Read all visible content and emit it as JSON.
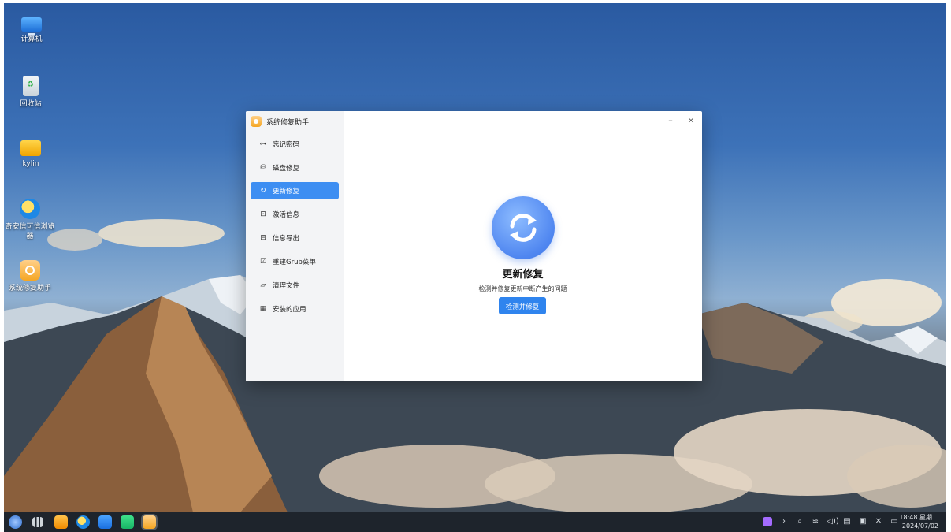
{
  "desktop": {
    "icons": [
      {
        "label": "计算机",
        "icon": "computer-icon"
      },
      {
        "label": "回收站",
        "icon": "trash-icon"
      },
      {
        "label": "kylin",
        "icon": "folder-icon"
      },
      {
        "label": "奇安信可信浏览器",
        "icon": "browser-icon"
      },
      {
        "label": "系统修复助手",
        "icon": "repair-assistant-icon"
      }
    ]
  },
  "window": {
    "title": "系统修复助手",
    "minimize_glyph": "–",
    "close_glyph": "×",
    "nav": [
      {
        "label": "忘记密码",
        "icon": "key-icon",
        "glyph": "⊶"
      },
      {
        "label": "磁盘修复",
        "icon": "disk-icon",
        "glyph": "⛁"
      },
      {
        "label": "更新修复",
        "icon": "refresh-icon",
        "glyph": "↻",
        "active": true
      },
      {
        "label": "激活信息",
        "icon": "activation-icon",
        "glyph": "⊡"
      },
      {
        "label": "信息导出",
        "icon": "export-icon",
        "glyph": "⊟"
      },
      {
        "label": "重建Grub菜单",
        "icon": "grub-icon",
        "glyph": "☑"
      },
      {
        "label": "清理文件",
        "icon": "folder-open-icon",
        "glyph": "▱"
      },
      {
        "label": "安装的应用",
        "icon": "apps-grid-icon",
        "glyph": "▦"
      }
    ],
    "content": {
      "title": "更新修复",
      "description": "检测并修复更新中断产生的问题",
      "button": "检测并修复"
    }
  },
  "taskbar": {
    "tray": [
      "›",
      "⌕",
      "≋",
      "◁))",
      "▤",
      "▣",
      "✕",
      "▭"
    ],
    "time": "18:48 星期二",
    "date": "2024/07/02"
  },
  "colors": {
    "accent": "#2f84ee",
    "active_nav": "#3d8ef2",
    "sidebar_bg": "#f3f4f6",
    "taskbar_bg": "#1e242c"
  }
}
